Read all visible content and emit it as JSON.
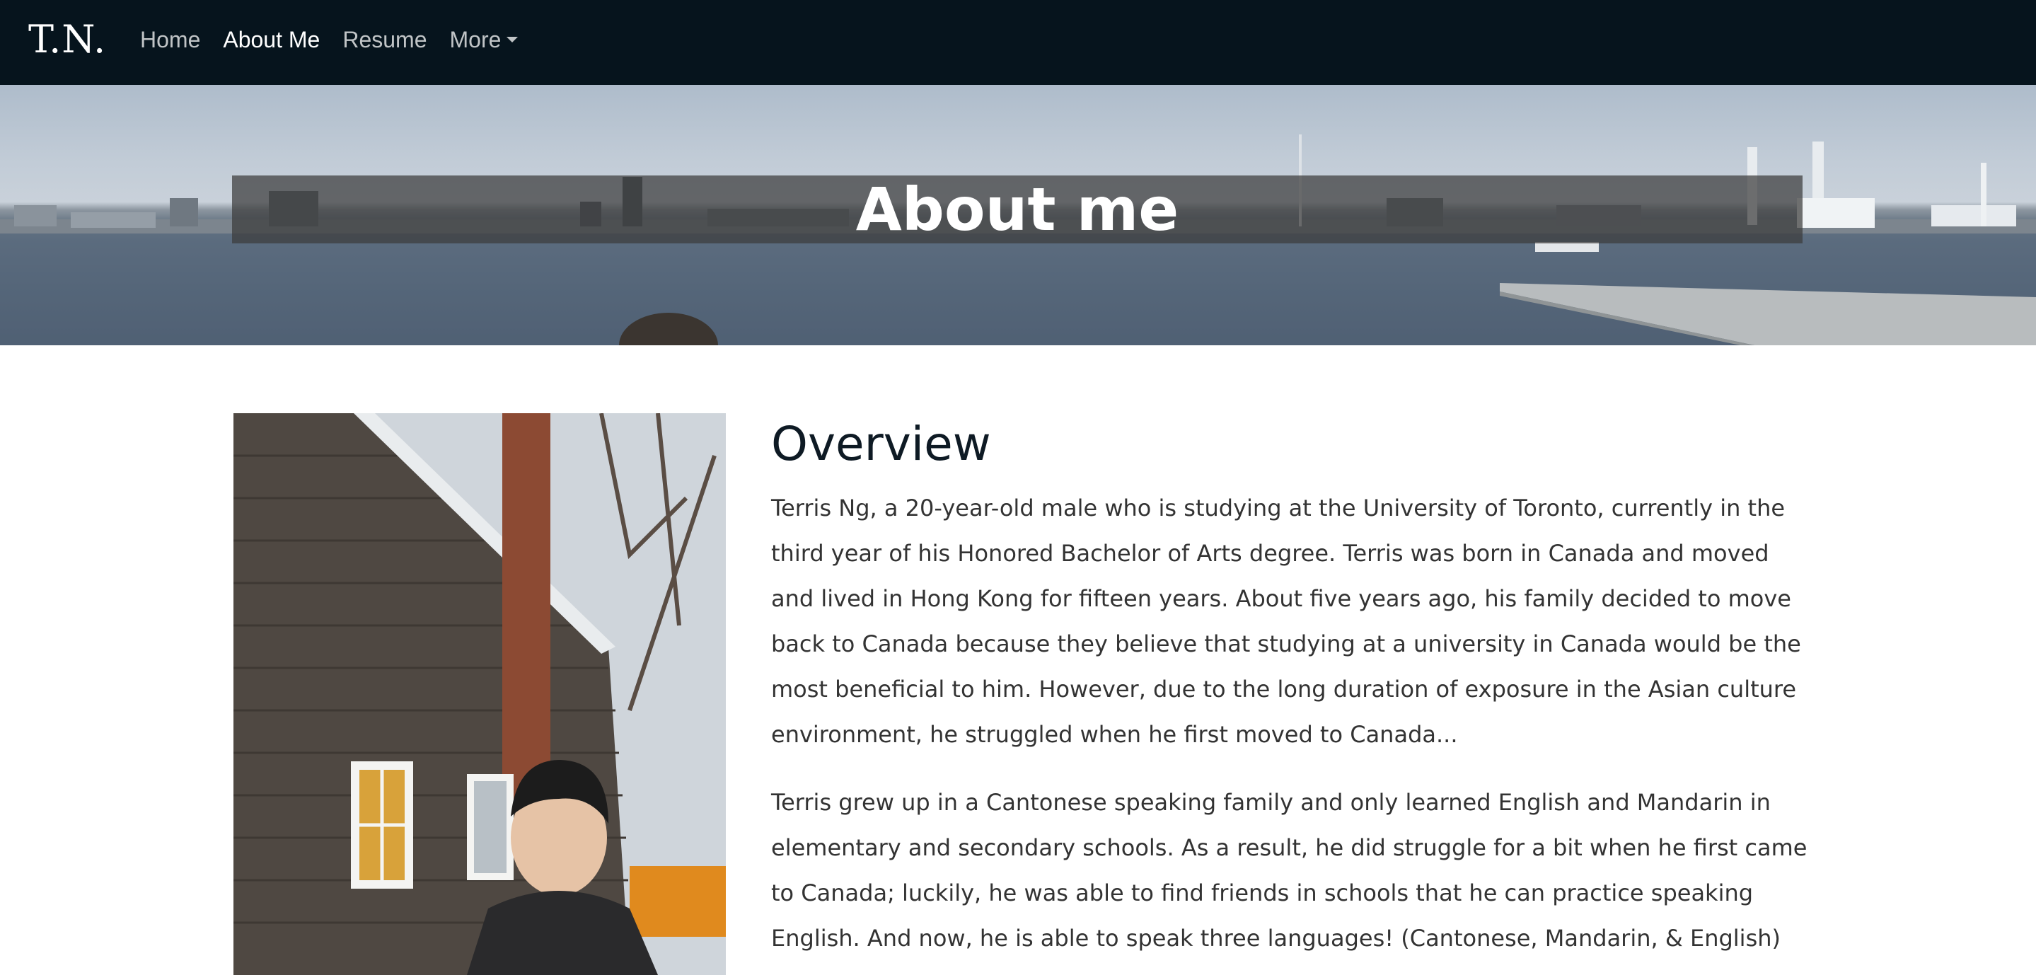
{
  "navbar": {
    "brand": "T.N.",
    "links": [
      {
        "label": "Home"
      },
      {
        "label": "About Me"
      },
      {
        "label": "Resume"
      },
      {
        "label": "More"
      }
    ]
  },
  "hero": {
    "title": "About me"
  },
  "main": {
    "section_title": "Overview",
    "paragraphs": [
      "Terris Ng, a 20-year-old male who is studying at the University of Toronto, currently in the third year of his Honored Bachelor of Arts degree. Terris was born in Canada and moved and lived in Hong Kong for fifteen years. About five years ago, his family decided to move back to Canada because they believe that studying at a university in Canada would be the most beneficial to him. However, due to the long duration of exposure in the Asian culture environment, he struggled when he first moved to Canada...",
      "Terris grew up in a Cantonese speaking family and only learned English and Mandarin in elementary and secondary schools. As a result, he did struggle for a bit when he first came to Canada; luckily, he was able to find friends in schools that he can practice speaking English. And now, he is able to speak three languages! (Cantonese, Mandarin, & English)"
    ]
  }
}
